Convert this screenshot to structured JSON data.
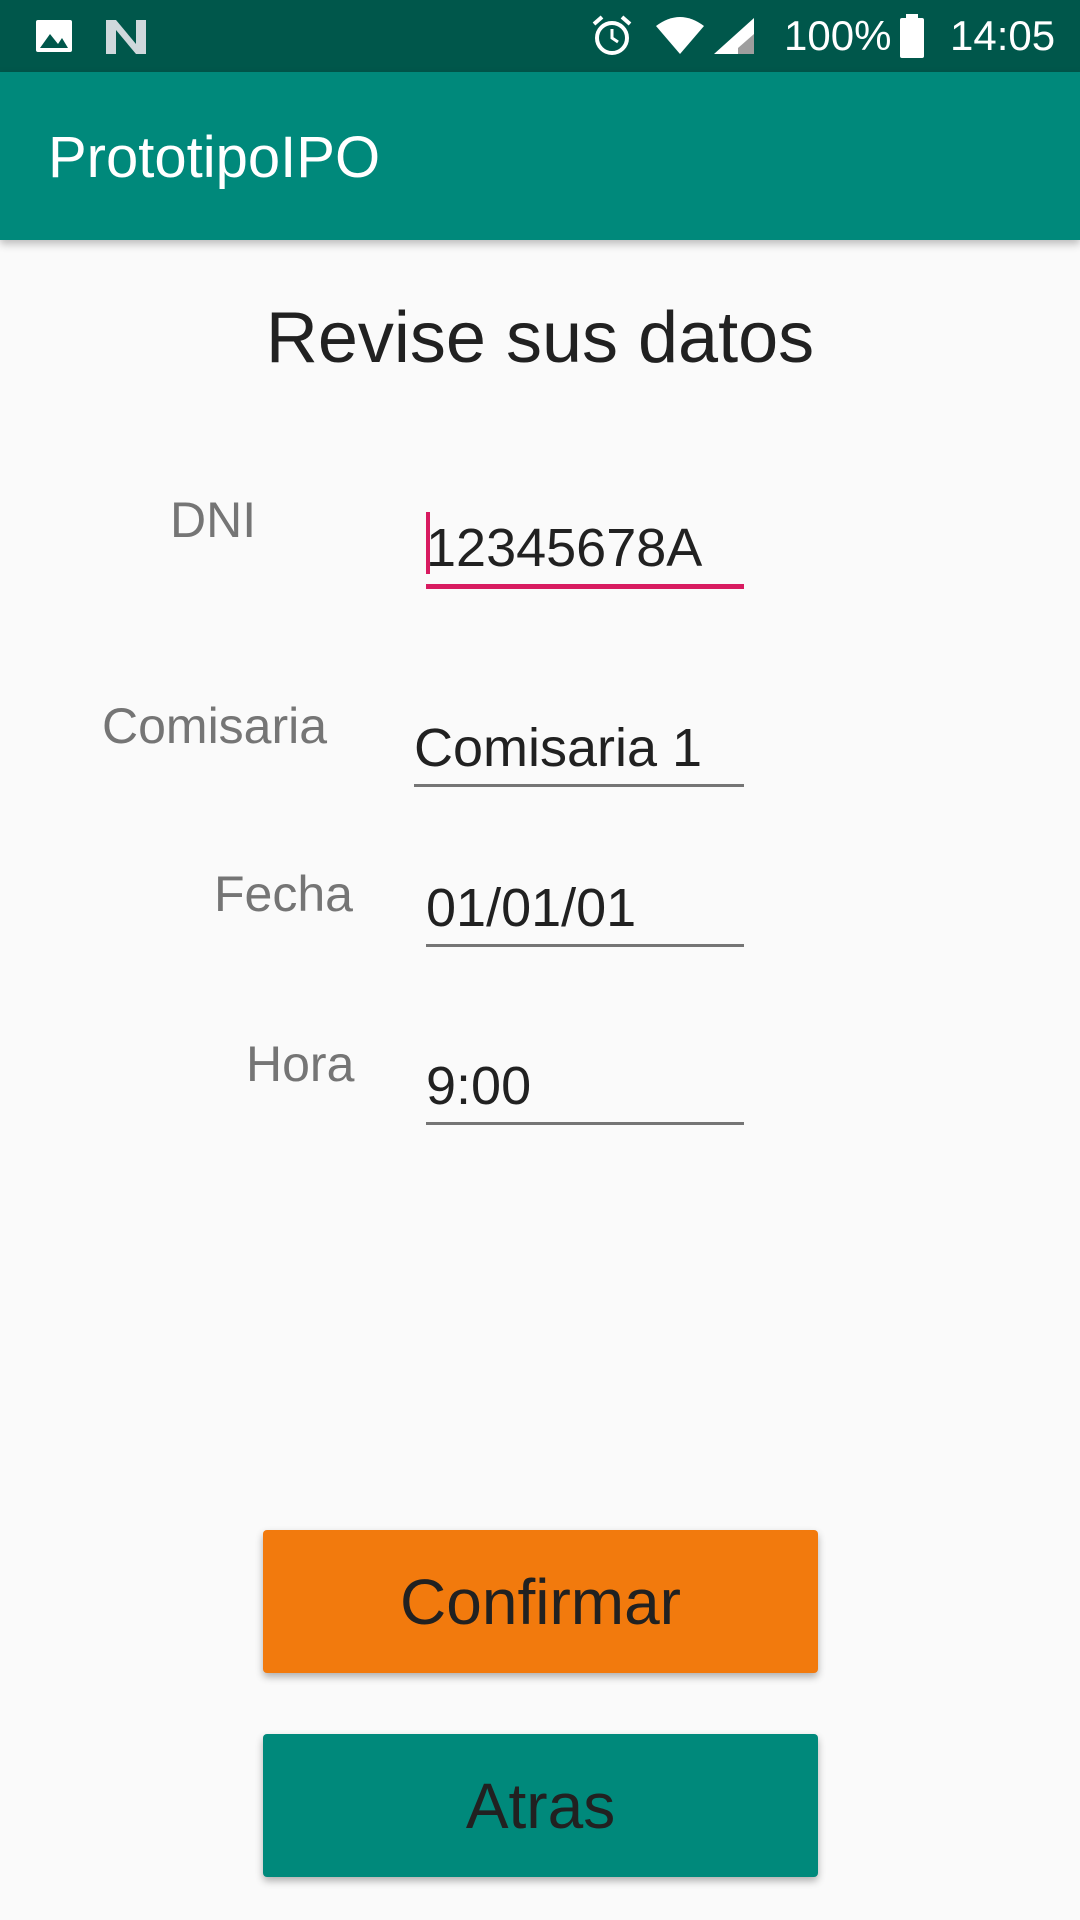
{
  "status_bar": {
    "icons": [
      "photo-icon",
      "n-icon",
      "alarm-icon",
      "wifi-icon",
      "signal-icon",
      "battery-icon"
    ],
    "battery_text": "100%",
    "time": "14:05"
  },
  "app_bar": {
    "title": "PrototipoIPO",
    "color": "#00897b"
  },
  "screen": {
    "title": "Revise sus datos"
  },
  "form": {
    "dni_label": "DNI",
    "dni_value": "12345678A",
    "comisaria_label": "Comisaria",
    "comisaria_value": "Comisaria 1",
    "fecha_label": "Fecha",
    "fecha_value": "01/01/01",
    "hora_label": "Hora",
    "hora_value": "9:00"
  },
  "buttons": {
    "confirm_label": "Confirmar",
    "confirm_color": "#f27a0d",
    "back_label": "Atras",
    "back_color": "#00897b"
  },
  "colors": {
    "status_bar": "#00574b",
    "accent": "#d81b60",
    "background": "#fafafa"
  }
}
